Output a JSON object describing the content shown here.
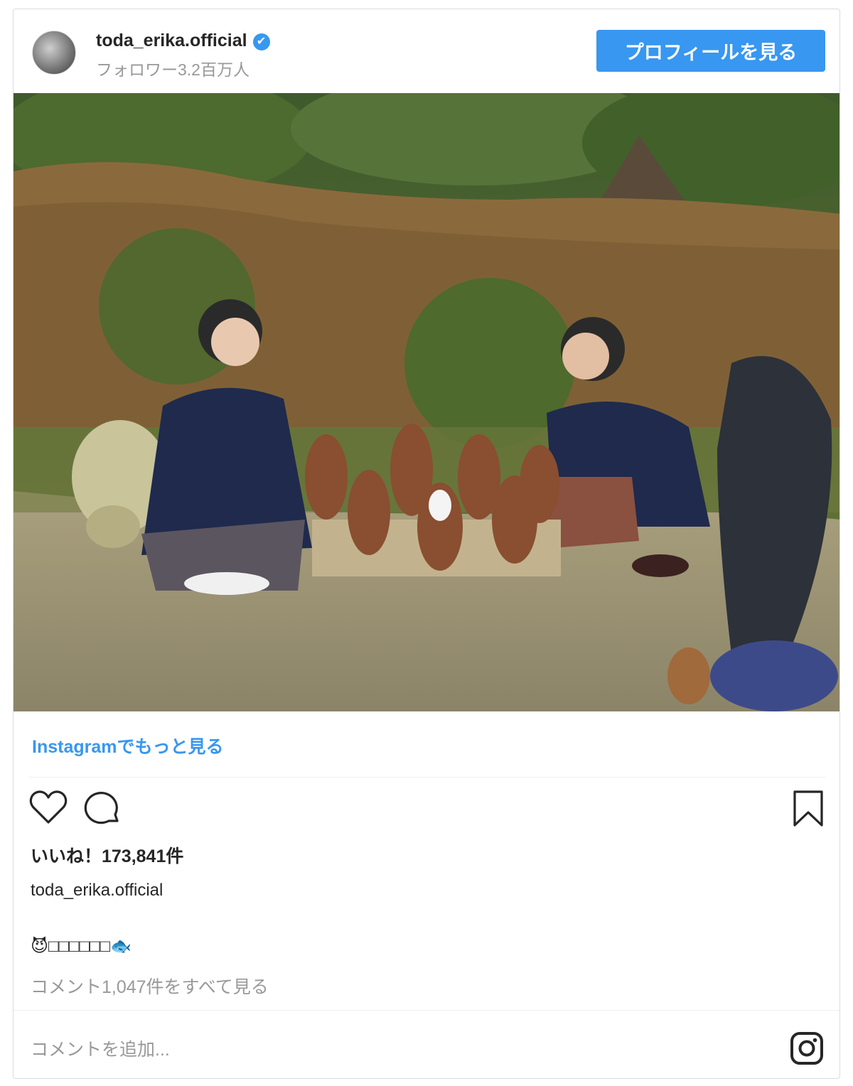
{
  "header": {
    "username": "toda_erika.official",
    "verified_glyph": "✔",
    "followers": "フォロワー3.2百万人",
    "profile_button": "プロフィールを見る"
  },
  "post": {
    "photo_alt": "garden-photo",
    "more_link": "Instagramでもっと見る",
    "likes": "いいね！173,841件",
    "caption_user": "toda_erika.official",
    "caption_text": "😈□□□□□□🐟",
    "view_comments": "コメント1,047件をすべて見る",
    "add_comment_placeholder": "コメントを追加..."
  },
  "icons": {
    "like": "heart-icon",
    "comment": "comment-icon",
    "save": "bookmark-icon",
    "instagram": "instagram-icon",
    "verified": "verified-badge-icon"
  },
  "colors": {
    "accent": "#3897f0",
    "text": "#262626",
    "muted": "#999999",
    "border": "#dbdbdb"
  }
}
